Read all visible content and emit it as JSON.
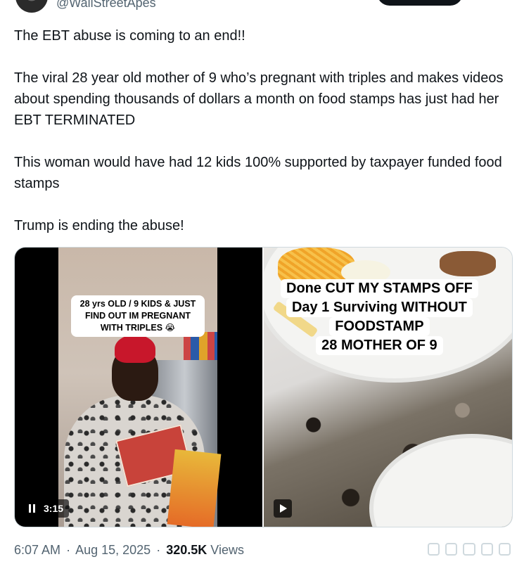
{
  "author": {
    "handle": "@WallStreetApes"
  },
  "tweet": {
    "paragraphs": [
      "The EBT abuse is coming to an end!!",
      "The viral 28 year old mother of 9 who’s pregnant with triples and makes videos about spending thousands of dollars a month on food stamps has just had her EBT TERMINATED",
      "This woman would have had 12 kids 100% supported by taxpayer funded food stamps",
      "Trump is ending the abuse!"
    ]
  },
  "media": {
    "left": {
      "overlay_text": "28 yrs OLD / 9 KIDS & JUST FIND OUT IM PREGNANT WITH TRIPLES 😭",
      "duration": "3:15"
    },
    "right": {
      "overlay_lines": [
        "Done CUT MY STAMPS OFF",
        "Day 1 Surviving WITHOUT",
        "FOODSTAMP",
        "28 MOTHER OF 9"
      ]
    }
  },
  "meta": {
    "time": "6:07 AM",
    "separator": "·",
    "date": "Aug 15, 2025",
    "views_count": "320.5K",
    "views_label": "Views"
  }
}
